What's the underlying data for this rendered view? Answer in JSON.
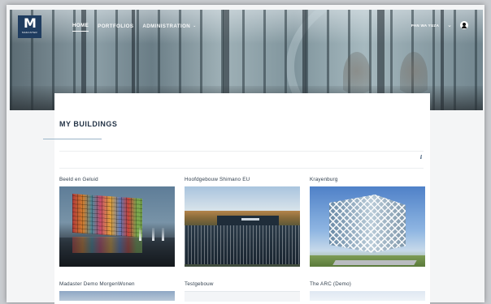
{
  "app": {
    "logo_mark": "M",
    "logo_word": "MADASTER"
  },
  "nav": {
    "items": [
      {
        "label": "HOME",
        "active": true
      },
      {
        "label": "PORTFOLIOS",
        "active": false
      },
      {
        "label": "ADMINISTRATION",
        "active": false
      }
    ],
    "admin_caret": "⌄"
  },
  "user": {
    "name": "PAN WA YUZA",
    "menu_chevron": "⌄",
    "avatar_icon": "user-avatar-icon"
  },
  "page": {
    "title": "MY BUILDINGS",
    "info_icon": "i"
  },
  "buildings": [
    {
      "name": "Beeld en Geluid"
    },
    {
      "name": "Hoofdgebouw Shimano EU"
    },
    {
      "name": "Krayenburg"
    },
    {
      "name": "Madaster Demo MorgenWonen"
    },
    {
      "name": "Testgebouw"
    },
    {
      "name": "The ARC (Demo)"
    }
  ],
  "colors": {
    "logo_bg": "#1f3c5f",
    "title_text": "#243447",
    "underline_accent": "#9ab4c8"
  }
}
